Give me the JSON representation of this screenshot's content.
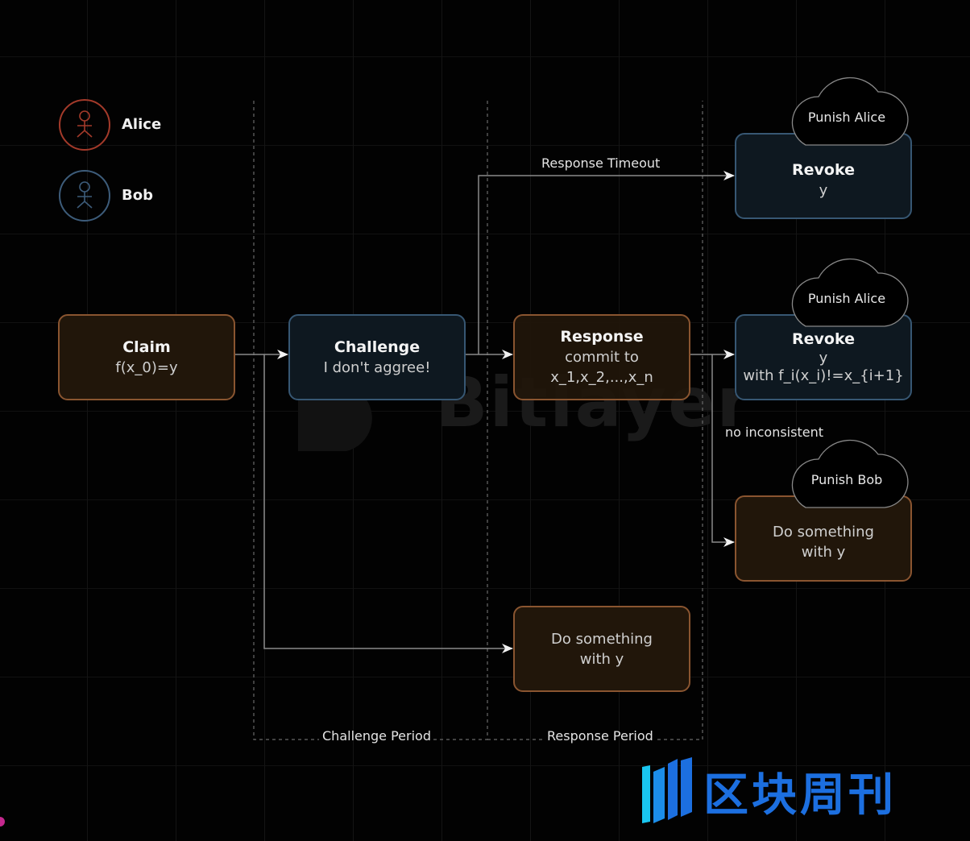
{
  "actors": [
    {
      "name": "Alice",
      "color": "#a33a2a"
    },
    {
      "name": "Bob",
      "color": "#3d5c7a"
    }
  ],
  "nodes": {
    "claim": {
      "title": "Claim",
      "lines": [
        "f(x_0)=y"
      ]
    },
    "challenge": {
      "title": "Challenge",
      "lines": [
        "I don't aggree!"
      ]
    },
    "response": {
      "title": "Response",
      "lines": [
        "commit to",
        "x_1,x_2,...,x_n"
      ]
    },
    "revoke_timeout": {
      "title": "Revoke",
      "lines": [
        "y"
      ]
    },
    "revoke_inconsistent": {
      "title": "Revoke",
      "lines": [
        "y",
        "with f_i(x_i)!=x_{i+1}"
      ]
    },
    "do_something_bob": {
      "title": "",
      "lines": [
        "Do something",
        "with y"
      ]
    },
    "do_something_challenge": {
      "title": "",
      "lines": [
        "Do something",
        "with y"
      ]
    }
  },
  "clouds": {
    "punish_alice_1": "Punish Alice",
    "punish_alice_2": "Punish Alice",
    "punish_bob": "Punish Bob"
  },
  "edge_labels": {
    "response_timeout": "Response Timeout",
    "no_inconsistent": "no inconsistent"
  },
  "periods": {
    "challenge": "Challenge Period",
    "response": "Response Period"
  },
  "watermark": "Bitlayer",
  "brand": "区块周刊",
  "colors": {
    "orange_border": "#8a5530",
    "blue_border": "#375773",
    "brand_blue": "#1c6fe0",
    "brand_cyan": "#19c6f0"
  }
}
